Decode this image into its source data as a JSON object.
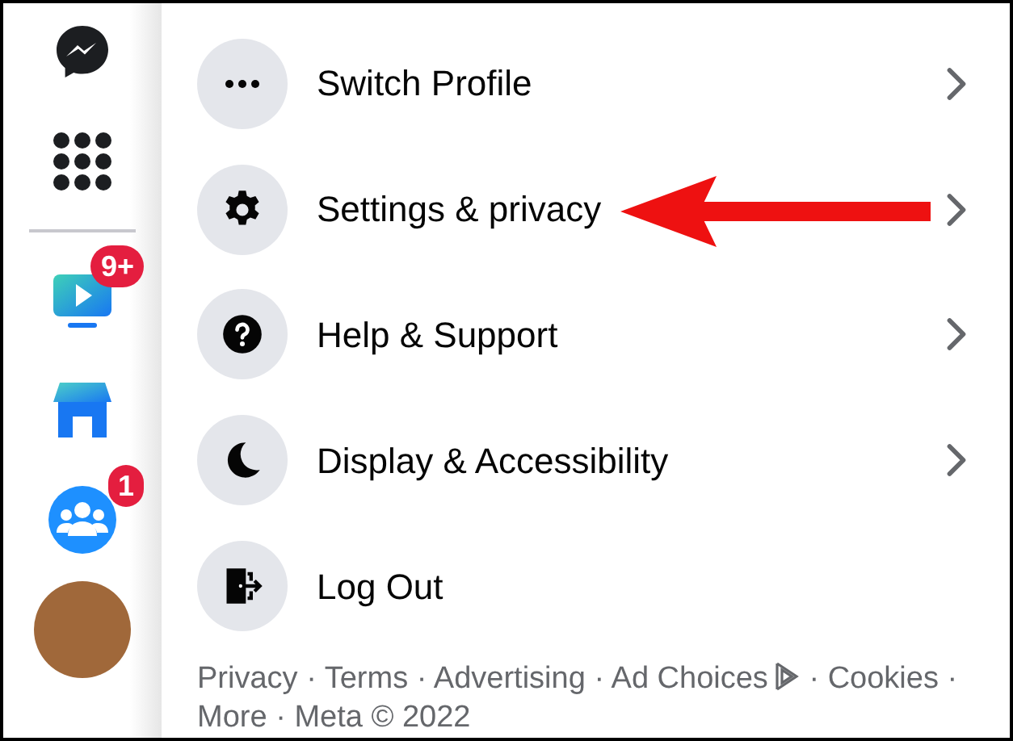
{
  "sidebar": {
    "items": [
      {
        "kind": "messenger"
      },
      {
        "kind": "apps"
      },
      {
        "kind": "divider"
      },
      {
        "kind": "watch",
        "badge": "9+"
      },
      {
        "kind": "marketplace"
      },
      {
        "kind": "groups",
        "badge": "1"
      },
      {
        "kind": "avatar"
      }
    ]
  },
  "menu": {
    "items": [
      {
        "kind": "dots",
        "label": "Switch Profile",
        "chevron": true,
        "annotated": false
      },
      {
        "kind": "gear",
        "label": "Settings & privacy",
        "chevron": true,
        "annotated": true
      },
      {
        "kind": "help",
        "label": "Help & Support",
        "chevron": true,
        "annotated": false
      },
      {
        "kind": "moon",
        "label": "Display & Accessibility",
        "chevron": true,
        "annotated": false
      },
      {
        "kind": "logout",
        "label": "Log Out",
        "chevron": false,
        "annotated": false
      }
    ]
  },
  "footer": {
    "separator": "·",
    "links": [
      {
        "label": "Privacy",
        "kind": "link"
      },
      {
        "label": "Terms",
        "kind": "link"
      },
      {
        "label": "Advertising",
        "kind": "link"
      },
      {
        "label": "Ad Choices",
        "kind": "ad_choices"
      },
      {
        "label": "Cookies",
        "kind": "link"
      },
      {
        "label": "More",
        "kind": "link"
      }
    ],
    "copyright": "Meta © 2022"
  }
}
